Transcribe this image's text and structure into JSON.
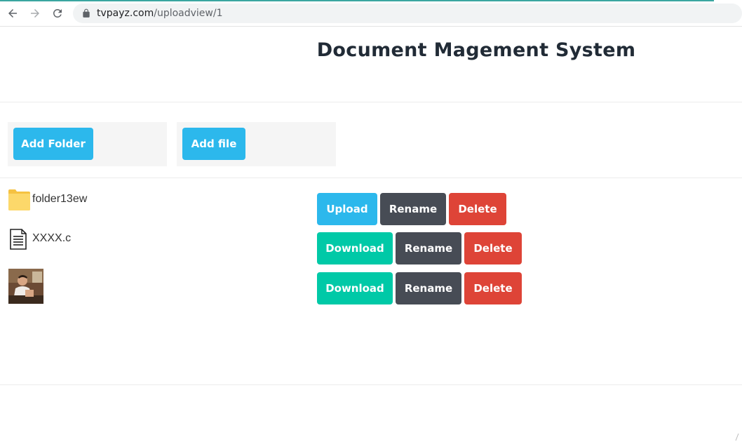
{
  "browser": {
    "url_host": "tvpayz.com",
    "url_path": "/uploadview/1"
  },
  "page": {
    "title": "Document Magement System"
  },
  "actions": {
    "add_folder_label": "Add Folder",
    "add_file_label": "Add file"
  },
  "items": [
    {
      "type": "folder",
      "icon": "folder-icon",
      "name": "folder13ew",
      "buttons": [
        "Upload",
        "Rename",
        "Delete"
      ]
    },
    {
      "type": "file",
      "icon": "document-icon",
      "name": "XXXX.c",
      "buttons": [
        "Download",
        "Rename",
        "Delete"
      ]
    },
    {
      "type": "image",
      "icon": "image-thumbnail",
      "name": "",
      "buttons": [
        "Download",
        "Rename",
        "Delete"
      ]
    }
  ],
  "colors": {
    "primary_blue": "#2cb8ec",
    "dark": "#474c55",
    "danger_red": "#de4437",
    "teal": "#00c9a7",
    "title_text": "#212b36"
  }
}
